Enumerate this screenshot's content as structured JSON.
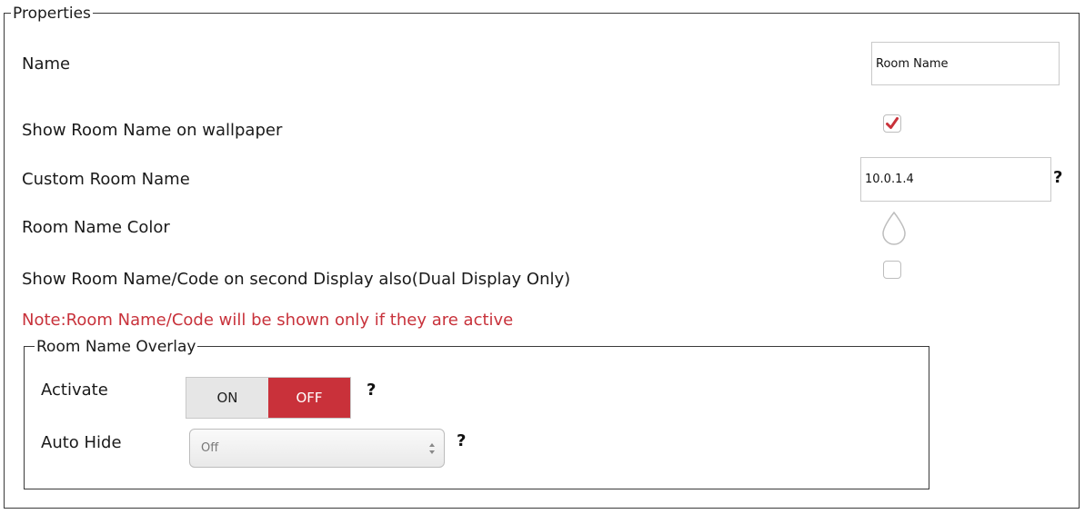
{
  "properties": {
    "legend": "Properties",
    "name": {
      "label": "Name",
      "value": "Room Name"
    },
    "show_on_wallpaper": {
      "label": "Show Room Name on wallpaper",
      "checked": true
    },
    "custom_room_name": {
      "label": "Custom Room Name",
      "value": "10.0.1.4",
      "help": "?"
    },
    "room_name_color": {
      "label": "Room Name Color",
      "icon": "color-drop-icon"
    },
    "second_display": {
      "label": "Show Room Name/Code on second Display also(Dual Display Only)",
      "checked": false
    },
    "note": "Note:Room Name/Code will be shown only if they are active"
  },
  "overlay": {
    "legend": "Room Name Overlay",
    "activate": {
      "label": "Activate",
      "on_label": "ON",
      "off_label": "OFF",
      "selected": "OFF",
      "help": "?"
    },
    "auto_hide": {
      "label": "Auto Hide",
      "value": "Off",
      "help": "?"
    }
  },
  "colors": {
    "accent_red": "#c9313a",
    "note_red": "#c8323b",
    "border": "#3a3a3a"
  }
}
